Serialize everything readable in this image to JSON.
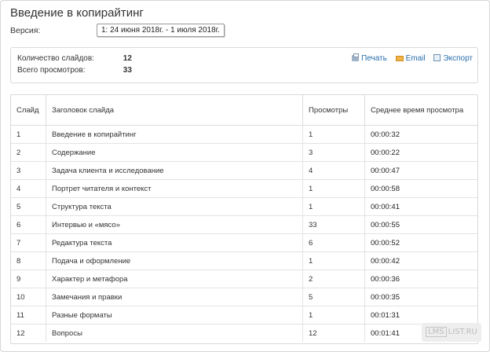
{
  "title": "Введение в копирайтинг",
  "version": {
    "label": "Версия:",
    "selected": "1: 24 июня 2018г. - 1 июля 2018г."
  },
  "summary": {
    "slides_label": "Количество слайдов:",
    "slides_value": "12",
    "views_label": "Всего просмотров:",
    "views_value": "33"
  },
  "actions": {
    "print": "Печать",
    "email": "Email",
    "export": "Экспорт"
  },
  "table": {
    "headers": [
      "Слайд",
      "Заголовок слайда",
      "Просмотры",
      "Среднее время просмотра"
    ],
    "rows": [
      [
        "1",
        "Введение в копирайтинг",
        "1",
        "00:00:32"
      ],
      [
        "2",
        "Содержание",
        "3",
        "00:00:22"
      ],
      [
        "3",
        "Задача клиента и исследование",
        "4",
        "00:00:47"
      ],
      [
        "4",
        "Портрет читателя и контекст",
        "1",
        "00:00:58"
      ],
      [
        "5",
        "Структура текста",
        "1",
        "00:00:41"
      ],
      [
        "6",
        "Интервью и «мясо»",
        "33",
        "00:00:55"
      ],
      [
        "7",
        "Редактура текста",
        "6",
        "00:00:52"
      ],
      [
        "8",
        "Подача и оформление",
        "1",
        "00:00:42"
      ],
      [
        "9",
        "Характер и метафора",
        "2",
        "00:00:36"
      ],
      [
        "10",
        "Замечания и правки",
        "5",
        "00:00:35"
      ],
      [
        "11",
        "Разные форматы",
        "1",
        "00:01:31"
      ],
      [
        "12",
        "Вопросы",
        "12",
        "00:01:41"
      ]
    ]
  },
  "watermark": {
    "box_text": "LMS",
    "suffix": "LIST.RU"
  }
}
